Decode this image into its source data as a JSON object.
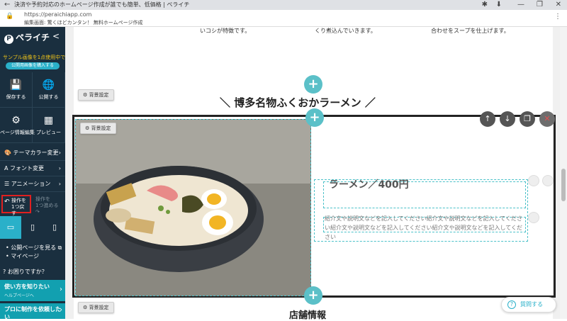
{
  "browser": {
    "tab_title": "決済や予約対応のホームページ作成が誰でも簡単、低価格 | ペライチ",
    "url": "https://peraichiapp.com",
    "page_subtitle": "編集画面: 驚くほどカンタン！ 無料ホームページ作成",
    "icons": [
      "back-icon",
      "reload-icon",
      "lock-icon",
      "extension-icon",
      "download-icon",
      "minimize-icon",
      "maximize-icon",
      "close-icon",
      "more-icon"
    ]
  },
  "sidebar": {
    "logo": "ペライチ",
    "collapse": "<",
    "sample_note": "サンプル画像を1点使用中です",
    "buy_button": "公開用画像を購入する",
    "tiles": [
      {
        "label": "保存する",
        "icon": "💾"
      },
      {
        "label": "公開する",
        "icon": "🌐"
      },
      {
        "label": "ページ情報編集",
        "icon": "⚙"
      },
      {
        "label": "プレビュー",
        "icon": "▦"
      }
    ],
    "menu": [
      {
        "label": "テーマカラー変更",
        "icon": "🎨"
      },
      {
        "label": "フォント変更",
        "icon": "A"
      },
      {
        "label": "アニメーション",
        "icon": "☰"
      }
    ],
    "undo": "操作を\n1つ戻す",
    "redo": "操作を\n1つ進める",
    "links": [
      "公開ページを見る",
      "マイページ"
    ],
    "help": "お困りですか？",
    "promo1_title": "使い方を知りたい",
    "promo1_sub": "ヘルプページへ",
    "promo2_title": "プロに制作を依頼したい",
    "accent": "#2ab0c9",
    "bg": "#1a2f3f"
  },
  "editor": {
    "top_texts": [
      "いコシが特徴です。",
      "くり煮込んでいきます。",
      "合わせをスープを仕上げます。"
    ],
    "bg_setting": "背景設定",
    "heading": "＼ 博多名物ふくおかラーメン ／",
    "item_title": "ラーメン／400円",
    "item_desc": "紹介文や説明文などを記入してください紹介文や説明文などを記入してください紹介文や説明文などを記入してください紹介文や説明文などを記入してください",
    "store_heading": "店舗情報",
    "ask_button": "質問する",
    "plus": "+",
    "tools": [
      "↑",
      "↓",
      "❐",
      "✕"
    ]
  }
}
